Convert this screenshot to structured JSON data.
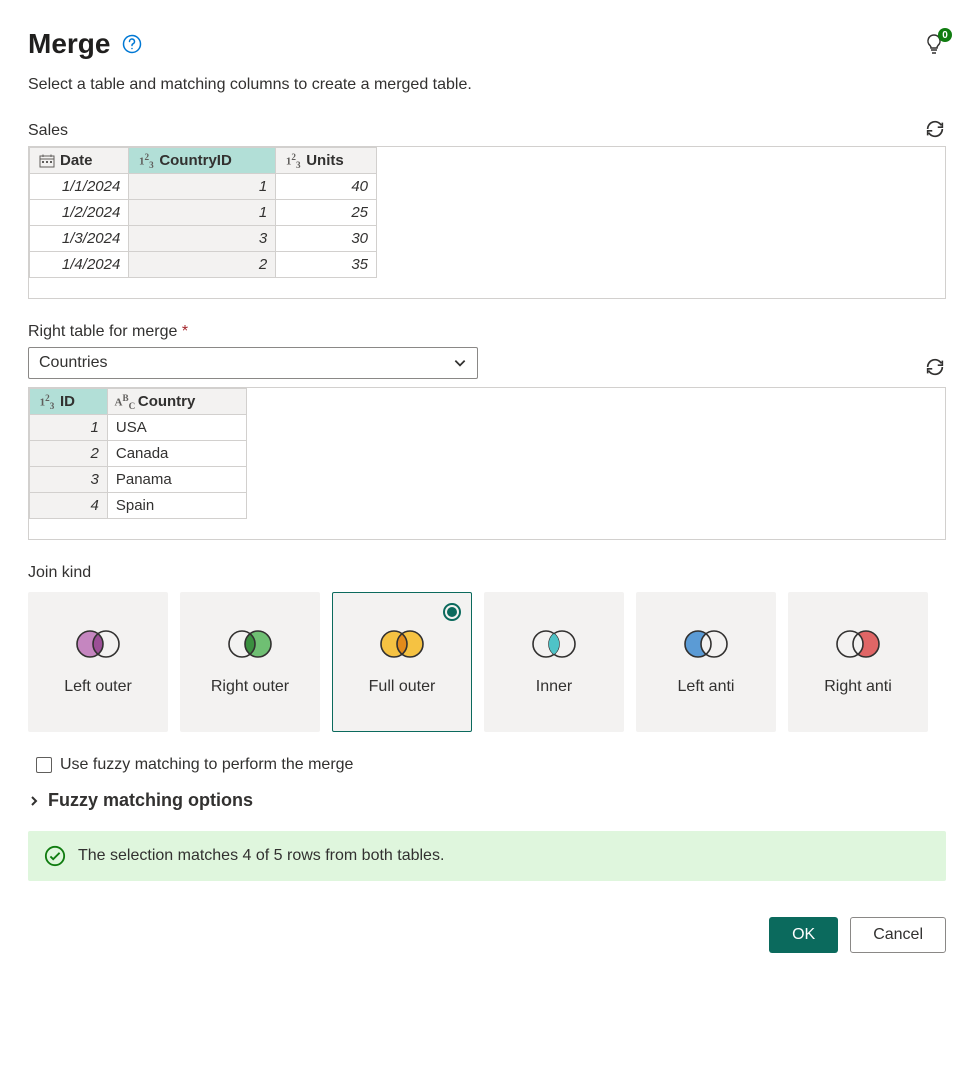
{
  "header": {
    "title": "Merge",
    "tips_badge": "0",
    "subtitle": "Select a table and matching columns to create a merged table."
  },
  "left_table": {
    "name": "Sales",
    "columns": [
      {
        "label": "Date",
        "type": "date",
        "selected": false
      },
      {
        "label": "CountryID",
        "type": "number",
        "selected": true
      },
      {
        "label": "Units",
        "type": "number",
        "selected": false
      }
    ],
    "rows": [
      {
        "Date": "1/1/2024",
        "CountryID": "1",
        "Units": "40"
      },
      {
        "Date": "1/2/2024",
        "CountryID": "1",
        "Units": "25"
      },
      {
        "Date": "1/3/2024",
        "CountryID": "3",
        "Units": "30"
      },
      {
        "Date": "1/4/2024",
        "CountryID": "2",
        "Units": "35"
      }
    ]
  },
  "right_label": "Right table for merge",
  "right_select_value": "Countries",
  "right_table": {
    "columns": [
      {
        "label": "ID",
        "type": "number",
        "selected": true
      },
      {
        "label": "Country",
        "type": "text",
        "selected": false
      }
    ],
    "rows": [
      {
        "ID": "1",
        "Country": "USA"
      },
      {
        "ID": "2",
        "Country": "Canada"
      },
      {
        "ID": "3",
        "Country": "Panama"
      },
      {
        "ID": "4",
        "Country": "Spain"
      }
    ]
  },
  "join": {
    "label": "Join kind",
    "options": [
      {
        "id": "left-outer",
        "label": "Left outer"
      },
      {
        "id": "right-outer",
        "label": "Right outer"
      },
      {
        "id": "full-outer",
        "label": "Full outer"
      },
      {
        "id": "inner",
        "label": "Inner"
      },
      {
        "id": "left-anti",
        "label": "Left anti"
      },
      {
        "id": "right-anti",
        "label": "Right anti"
      }
    ],
    "selected": "full-outer"
  },
  "fuzzy": {
    "checkbox_label": "Use fuzzy matching to perform the merge",
    "options_label": "Fuzzy matching options"
  },
  "status_message": "The selection matches 4 of 5 rows from both tables.",
  "buttons": {
    "ok": "OK",
    "cancel": "Cancel"
  }
}
